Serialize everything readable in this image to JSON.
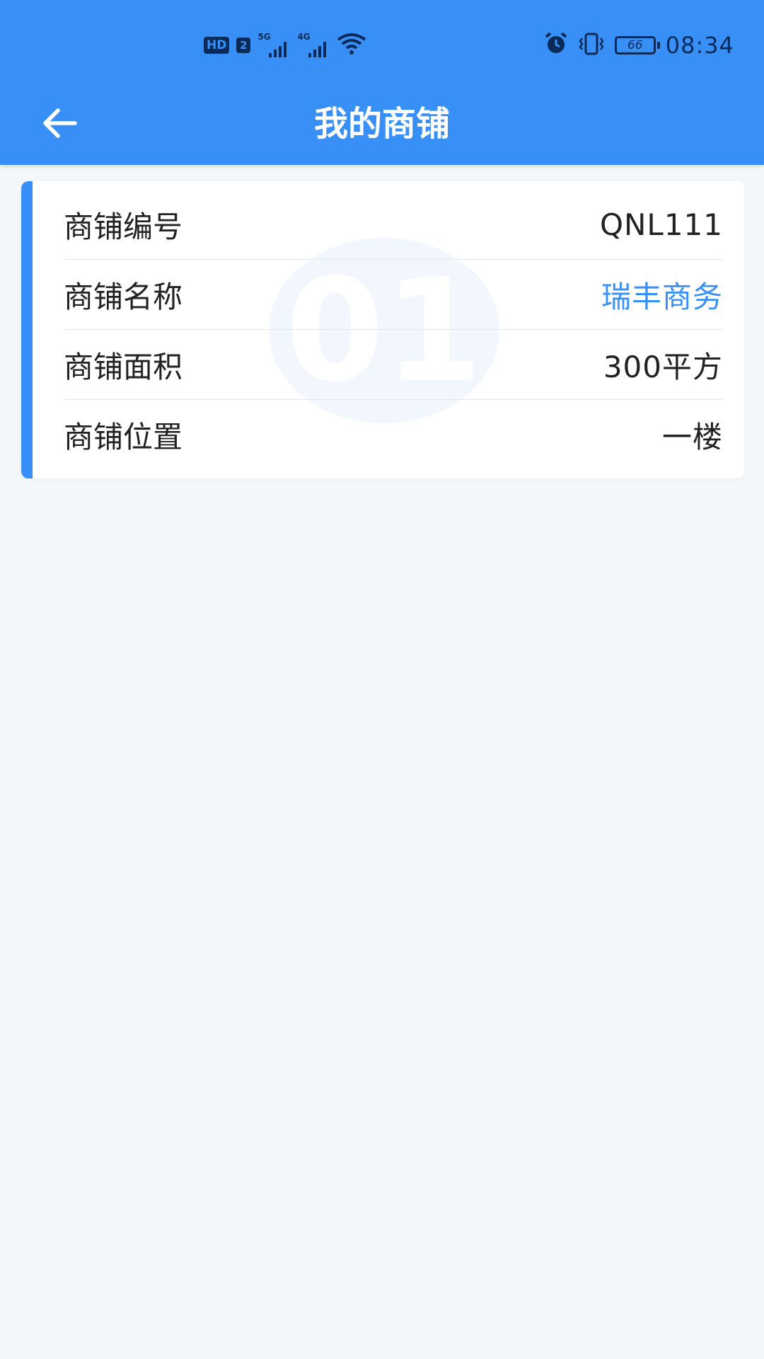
{
  "status_bar": {
    "hd": "HD",
    "sim": "2",
    "sig1_tag": "5G",
    "sig2_tag": "4G",
    "battery": "66",
    "time": "08:34"
  },
  "header": {
    "title": "我的商铺",
    "back_icon": "arrow-left-icon"
  },
  "card": {
    "watermark": "01",
    "rows": [
      {
        "label": "商铺编号",
        "value": "QNL111"
      },
      {
        "label": "商铺名称",
        "value": "瑞丰商务"
      },
      {
        "label": "商铺面积",
        "value": "300平方"
      },
      {
        "label": "商铺位置",
        "value": "一楼"
      }
    ]
  },
  "colors": {
    "primary": "#3890f7",
    "background": "#f4f7fa",
    "link": "#3890f7",
    "text": "#222222"
  }
}
